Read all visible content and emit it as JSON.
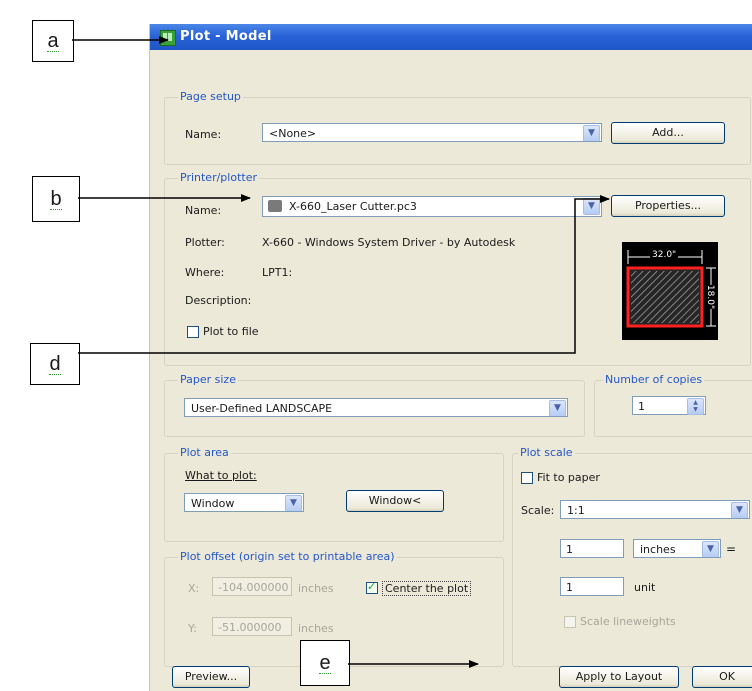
{
  "dialog": {
    "title": "Plot - Model",
    "page_setup": {
      "group_label": "Page setup",
      "name_label": "Name:",
      "name_value": "<None>",
      "add_button": "Add..."
    },
    "printer": {
      "group_label": "Printer/plotter",
      "name_label": "Name:",
      "name_value": "X-660_Laser Cutter.pc3",
      "properties_button": "Properties...",
      "plotter_label": "Plotter:",
      "plotter_value": "X-660 - Windows System Driver - by Autodesk",
      "where_label": "Where:",
      "where_value": "LPT1:",
      "description_label": "Description:",
      "plot_to_file_label": "Plot to file",
      "preview_width": "32.0\"",
      "preview_height": "18.0\""
    },
    "paper_size": {
      "group_label": "Paper size",
      "value": "User-Defined LANDSCAPE"
    },
    "copies": {
      "group_label": "Number of copies",
      "value": "1"
    },
    "plot_area": {
      "group_label": "Plot area",
      "what_label": "What to plot:",
      "what_value": "Window",
      "window_button": "Window<"
    },
    "plot_offset": {
      "group_label": "Plot offset (origin set to printable area)",
      "x_label": "X:",
      "x_value": "-104.000000",
      "x_unit": "inches",
      "y_label": "Y:",
      "y_value": "-51.000000",
      "y_unit": "inches",
      "center_label": "Center the plot"
    },
    "plot_scale": {
      "group_label": "Plot scale",
      "fit_label": "Fit to paper",
      "scale_label": "Scale:",
      "scale_value": "1:1",
      "value_one": "1",
      "units_value": "inches",
      "equals": "=",
      "value_two": "1",
      "unit_label": "unit",
      "lineweights_label": "Scale lineweights"
    },
    "buttons": {
      "preview": "Preview...",
      "apply": "Apply to Layout",
      "ok": "OK"
    }
  },
  "annotations": {
    "a": "a",
    "b": "b",
    "d": "d",
    "e": "e"
  },
  "colors": {
    "title_bar": "#2a63d8",
    "group_label": "#2456c8",
    "dialog_bg": "#ece9d8",
    "preview_highlight": "#ff2020"
  }
}
